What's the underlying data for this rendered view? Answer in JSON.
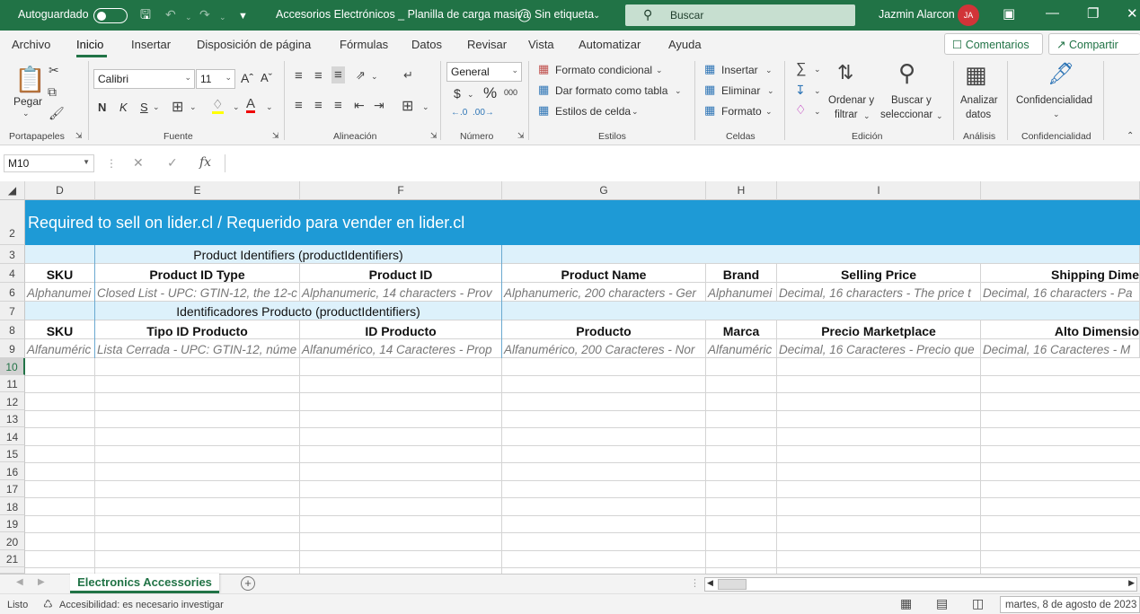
{
  "titlebar": {
    "autosave_label": "Autoguardado",
    "file_title": "Accesorios Electrónicos _ Planilla de carga masiva",
    "sensitivity": "Sin etiqueta",
    "search_placeholder": "Buscar",
    "user_name": "Jazmin Alarcon",
    "user_initials": "JA"
  },
  "menu": {
    "items": [
      "Archivo",
      "Inicio",
      "Insertar",
      "Disposición de página",
      "Fórmulas",
      "Datos",
      "Revisar",
      "Vista",
      "Automatizar",
      "Ayuda"
    ],
    "active": "Inicio",
    "comments": "Comentarios",
    "share": "Compartir"
  },
  "ribbon": {
    "clipboard": {
      "paste": "Pegar",
      "label": "Portapapeles"
    },
    "font": {
      "name": "Calibri",
      "size": "11",
      "bold": "N",
      "italic": "K",
      "underline": "S",
      "label": "Fuente"
    },
    "alignment": {
      "label": "Alineación"
    },
    "number": {
      "format": "General",
      "label": "Número"
    },
    "styles": {
      "conditional": "Formato condicional",
      "table": "Dar formato como tabla",
      "cell": "Estilos de celda",
      "label": "Estilos"
    },
    "cells": {
      "insert": "Insertar",
      "delete": "Eliminar",
      "format": "Formato",
      "label": "Celdas"
    },
    "editing": {
      "sort1": "Ordenar y",
      "sort2": "filtrar",
      "find1": "Buscar y",
      "find2": "seleccionar",
      "label": "Edición"
    },
    "analysis": {
      "btn1": "Analizar",
      "btn2": "datos",
      "label": "Análisis"
    },
    "confidentiality": {
      "btn": "Confidencialidad",
      "label": "Confidencialidad"
    }
  },
  "formula_bar": {
    "name_box": "M10",
    "fx": "fx",
    "value": ""
  },
  "grid": {
    "columns": [
      "D",
      "E",
      "F",
      "G",
      "H",
      "I"
    ],
    "rows": [
      "2",
      "3",
      "4",
      "6",
      "7",
      "8",
      "9",
      "10",
      "11",
      "12",
      "13",
      "14",
      "15",
      "16",
      "17",
      "18",
      "19",
      "20",
      "21"
    ],
    "banner": "Required to sell on lider.cl / Requerido para vender en lider.cl",
    "group_en": "Product Identifiers (productIdentifiers)",
    "group_es": "Identificadores Producto (productIdentifiers)",
    "headers_en": [
      "SKU",
      "Product ID Type",
      "Product ID",
      "Product Name",
      "Brand",
      "Selling Price",
      "Shipping Dime"
    ],
    "desc_en": [
      "Alphanumei",
      "Closed List - UPC: GTIN-12, the 12-c",
      "Alphanumeric, 14 characters - Prov",
      "Alphanumeric, 200 characters - Ger",
      "Alphanumei",
      "Decimal, 16 characters - The price t",
      "Decimal, 16 characters - Pa"
    ],
    "headers_es": [
      "SKU",
      "Tipo ID Producto",
      "ID Producto",
      "Producto",
      "Marca",
      "Precio Marketplace",
      "Alto Dimensio"
    ],
    "desc_es": [
      "Alfanuméric",
      "Lista Cerrada - UPC: GTIN-12, núme",
      "Alfanumérico, 14 Caracteres - Prop",
      "Alfanumérico, 200 Caracteres - Nor",
      "Alfanuméric",
      "Decimal, 16 Caracteres - Precio que",
      "Decimal, 16 Caracteres - M"
    ]
  },
  "sheets": {
    "active": "Electronics Accessories"
  },
  "status": {
    "ready": "Listo",
    "accessibility": "Accesibilidad: es necesario investigar",
    "date": "martes, 8 de agosto de 2023"
  },
  "colors": {
    "excel_green": "#217346",
    "banner_blue": "#1e9ad6",
    "light_blue": "#ddf1fb"
  }
}
